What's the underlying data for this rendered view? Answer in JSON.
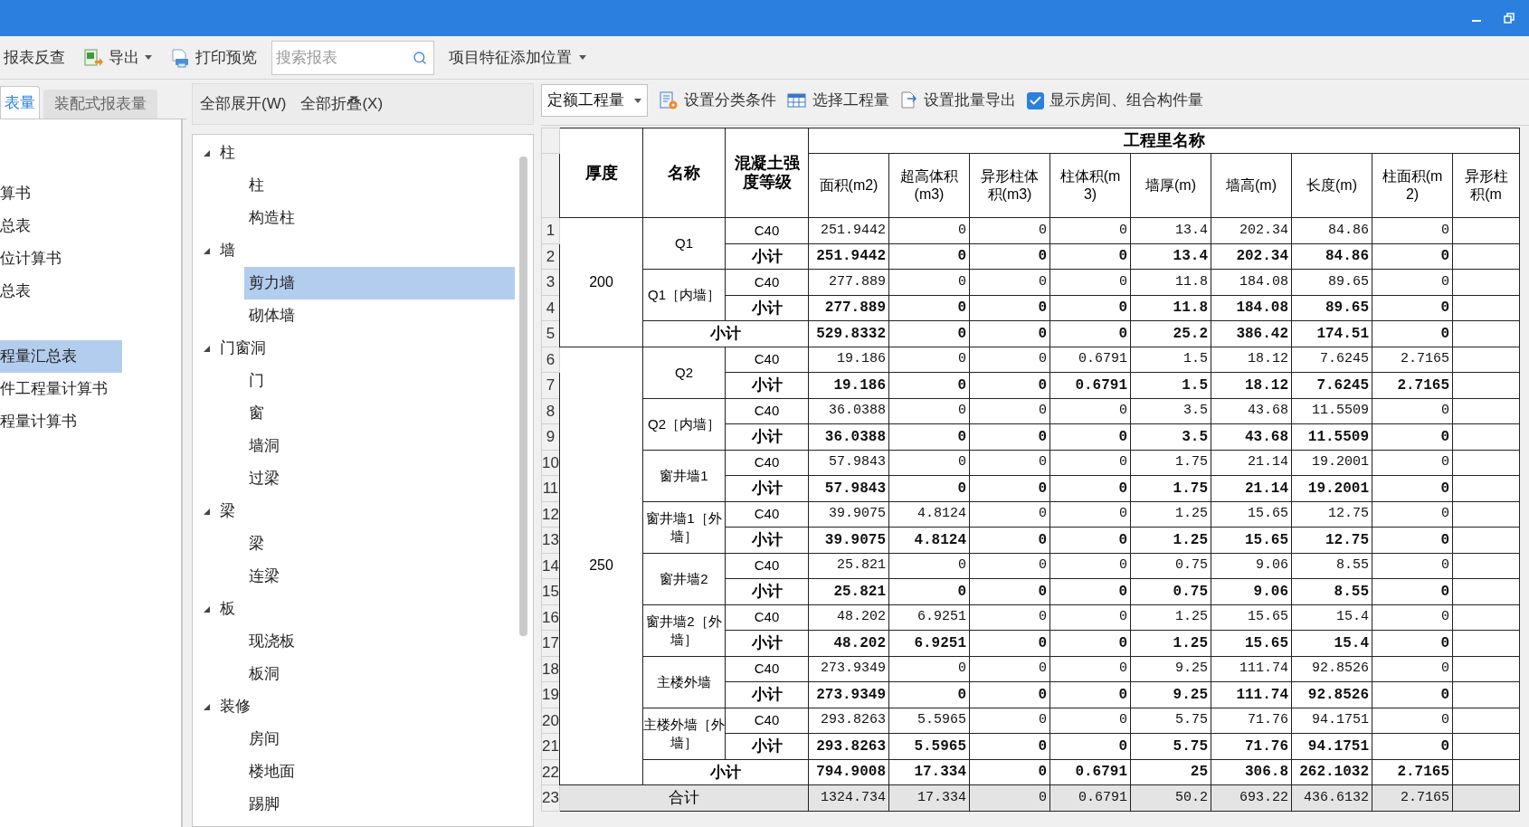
{
  "toolbar": {
    "items": [
      {
        "kind": "plain",
        "label": "报表反查"
      },
      {
        "kind": "export",
        "label": "导出"
      },
      {
        "kind": "print",
        "label": "打印预览"
      }
    ],
    "search": {
      "placeholder": "搜索报表"
    },
    "position_menu": "项目特征添加位置"
  },
  "left_panel": {
    "tabs": [
      {
        "label": "表量",
        "selected": true
      },
      {
        "label": "装配式报表量",
        "selected": false
      }
    ],
    "groups": [
      {
        "items": [
          {
            "label": "算书",
            "selected": false
          },
          {
            "label": "总表",
            "selected": false
          },
          {
            "label": "位计算书",
            "selected": false
          },
          {
            "label": "总表",
            "selected": false
          }
        ]
      },
      {
        "items": [
          {
            "label": "程量汇总表",
            "selected": true
          },
          {
            "label": "件工程量计算书",
            "selected": false
          },
          {
            "label": "程量计算书",
            "selected": false
          }
        ]
      }
    ]
  },
  "tree_panel": {
    "actions": [
      "全部展开(W)",
      "全部折叠(X)"
    ],
    "tree": [
      {
        "label": "柱",
        "expanded": true,
        "children": [
          {
            "label": "柱",
            "selected": false
          },
          {
            "label": "构造柱",
            "selected": false
          }
        ]
      },
      {
        "label": "墙",
        "expanded": true,
        "children": [
          {
            "label": "剪力墙",
            "selected": true
          },
          {
            "label": "砌体墙",
            "selected": false
          }
        ]
      },
      {
        "label": "门窗洞",
        "expanded": true,
        "children": [
          {
            "label": "门",
            "selected": false
          },
          {
            "label": "窗",
            "selected": false
          },
          {
            "label": "墙洞",
            "selected": false
          },
          {
            "label": "过梁",
            "selected": false
          }
        ]
      },
      {
        "label": "梁",
        "expanded": true,
        "children": [
          {
            "label": "梁",
            "selected": false
          },
          {
            "label": "连梁",
            "selected": false
          }
        ]
      },
      {
        "label": "板",
        "expanded": true,
        "children": [
          {
            "label": "现浇板",
            "selected": false
          },
          {
            "label": "板洞",
            "selected": false
          }
        ]
      },
      {
        "label": "装修",
        "expanded": true,
        "children": [
          {
            "label": "房间",
            "selected": false
          },
          {
            "label": "楼地面",
            "selected": false
          },
          {
            "label": "踢脚",
            "selected": false
          }
        ]
      }
    ]
  },
  "report_toolbar": {
    "mode_select": "定额工程量",
    "actions": [
      {
        "kind": "filter",
        "label": "设置分类条件"
      },
      {
        "kind": "grid",
        "label": "选择工程量"
      },
      {
        "kind": "export",
        "label": "设置批量导出"
      }
    ],
    "show_rooms": {
      "label": "显示房间、组合构件量",
      "checked": true
    }
  },
  "table": {
    "fixed_columns": [
      "厚度",
      "名称",
      "混凝土强度等级"
    ],
    "group_header": "工程里名称",
    "columns": [
      "面积(m2)",
      "超高体积(m3)",
      "异形柱体积(m3)",
      "柱体积(m3)",
      "墙厚(m)",
      "墙高(m)",
      "长度(m)",
      "柱面积(m2)",
      "异形柱积(m"
    ],
    "row_numbers": [
      "1",
      "2",
      "3",
      "4",
      "5",
      "6",
      "7",
      "8",
      "9",
      "10",
      "11",
      "12",
      "13",
      "14",
      "15",
      "16",
      "17",
      "18",
      "19",
      "20",
      "21",
      "22",
      "23"
    ],
    "groups": [
      {
        "thickness": "200",
        "items": [
          {
            "name": "Q1",
            "rows": [
              {
                "kind": "grade",
                "label": "C40",
                "values": [
                  "251.9442",
                  "0",
                  "0",
                  "0",
                  "13.4",
                  "202.34",
                  "84.86",
                  "0"
                ]
              },
              {
                "kind": "subtotal",
                "label": "小计",
                "values": [
                  "251.9442",
                  "0",
                  "0",
                  "0",
                  "13.4",
                  "202.34",
                  "84.86",
                  "0"
                ]
              }
            ]
          },
          {
            "name": "Q1［内墙］",
            "rows": [
              {
                "kind": "grade",
                "label": "C40",
                "values": [
                  "277.889",
                  "0",
                  "0",
                  "0",
                  "11.8",
                  "184.08",
                  "89.65",
                  "0"
                ]
              },
              {
                "kind": "subtotal",
                "label": "小计",
                "values": [
                  "277.889",
                  "0",
                  "0",
                  "0",
                  "11.8",
                  "184.08",
                  "89.65",
                  "0"
                ]
              }
            ]
          }
        ],
        "subtotal": {
          "label": "小计",
          "values": [
            "529.8332",
            "0",
            "0",
            "0",
            "25.2",
            "386.42",
            "174.51",
            "0"
          ]
        }
      },
      {
        "thickness": "250",
        "items": [
          {
            "name": "Q2",
            "rows": [
              {
                "kind": "grade",
                "label": "C40",
                "values": [
                  "19.186",
                  "0",
                  "0",
                  "0.6791",
                  "1.5",
                  "18.12",
                  "7.6245",
                  "2.7165"
                ]
              },
              {
                "kind": "subtotal",
                "label": "小计",
                "values": [
                  "19.186",
                  "0",
                  "0",
                  "0.6791",
                  "1.5",
                  "18.12",
                  "7.6245",
                  "2.7165"
                ]
              }
            ]
          },
          {
            "name": "Q2［内墙］",
            "rows": [
              {
                "kind": "grade",
                "label": "C40",
                "values": [
                  "36.0388",
                  "0",
                  "0",
                  "0",
                  "3.5",
                  "43.68",
                  "11.5509",
                  "0"
                ]
              },
              {
                "kind": "subtotal",
                "label": "小计",
                "values": [
                  "36.0388",
                  "0",
                  "0",
                  "0",
                  "3.5",
                  "43.68",
                  "11.5509",
                  "0"
                ]
              }
            ]
          },
          {
            "name": "窗井墙1",
            "rows": [
              {
                "kind": "grade",
                "label": "C40",
                "values": [
                  "57.9843",
                  "0",
                  "0",
                  "0",
                  "1.75",
                  "21.14",
                  "19.2001",
                  "0"
                ]
              },
              {
                "kind": "subtotal",
                "label": "小计",
                "values": [
                  "57.9843",
                  "0",
                  "0",
                  "0",
                  "1.75",
                  "21.14",
                  "19.2001",
                  "0"
                ]
              }
            ]
          },
          {
            "name": "窗井墙1［外墙］",
            "rows": [
              {
                "kind": "grade",
                "label": "C40",
                "values": [
                  "39.9075",
                  "4.8124",
                  "0",
                  "0",
                  "1.25",
                  "15.65",
                  "12.75",
                  "0"
                ]
              },
              {
                "kind": "subtotal",
                "label": "小计",
                "values": [
                  "39.9075",
                  "4.8124",
                  "0",
                  "0",
                  "1.25",
                  "15.65",
                  "12.75",
                  "0"
                ]
              }
            ]
          },
          {
            "name": "窗井墙2",
            "rows": [
              {
                "kind": "grade",
                "label": "C40",
                "values": [
                  "25.821",
                  "0",
                  "0",
                  "0",
                  "0.75",
                  "9.06",
                  "8.55",
                  "0"
                ]
              },
              {
                "kind": "subtotal",
                "label": "小计",
                "values": [
                  "25.821",
                  "0",
                  "0",
                  "0",
                  "0.75",
                  "9.06",
                  "8.55",
                  "0"
                ]
              }
            ]
          },
          {
            "name": "窗井墙2［外墙］",
            "rows": [
              {
                "kind": "grade",
                "label": "C40",
                "values": [
                  "48.202",
                  "6.9251",
                  "0",
                  "0",
                  "1.25",
                  "15.65",
                  "15.4",
                  "0"
                ]
              },
              {
                "kind": "subtotal",
                "label": "小计",
                "values": [
                  "48.202",
                  "6.9251",
                  "0",
                  "0",
                  "1.25",
                  "15.65",
                  "15.4",
                  "0"
                ]
              }
            ]
          },
          {
            "name": "主楼外墙",
            "rows": [
              {
                "kind": "grade",
                "label": "C40",
                "values": [
                  "273.9349",
                  "0",
                  "0",
                  "0",
                  "9.25",
                  "111.74",
                  "92.8526",
                  "0"
                ]
              },
              {
                "kind": "subtotal",
                "label": "小计",
                "values": [
                  "273.9349",
                  "0",
                  "0",
                  "0",
                  "9.25",
                  "111.74",
                  "92.8526",
                  "0"
                ]
              }
            ]
          },
          {
            "name": "主楼外墙［外墙］",
            "rows": [
              {
                "kind": "grade",
                "label": "C40",
                "values": [
                  "293.8263",
                  "5.5965",
                  "0",
                  "0",
                  "5.75",
                  "71.76",
                  "94.1751",
                  "0"
                ]
              },
              {
                "kind": "subtotal",
                "label": "小计",
                "values": [
                  "293.8263",
                  "5.5965",
                  "0",
                  "0",
                  "5.75",
                  "71.76",
                  "94.1751",
                  "0"
                ]
              }
            ]
          }
        ],
        "subtotal": {
          "label": "小计",
          "values": [
            "794.9008",
            "17.334",
            "0",
            "0.6791",
            "25",
            "306.8",
            "262.1032",
            "2.7165"
          ]
        }
      }
    ],
    "total": {
      "label": "合计",
      "values": [
        "1324.734",
        "17.334",
        "0",
        "0.6791",
        "50.2",
        "693.22",
        "436.6132",
        "2.7165"
      ]
    }
  }
}
